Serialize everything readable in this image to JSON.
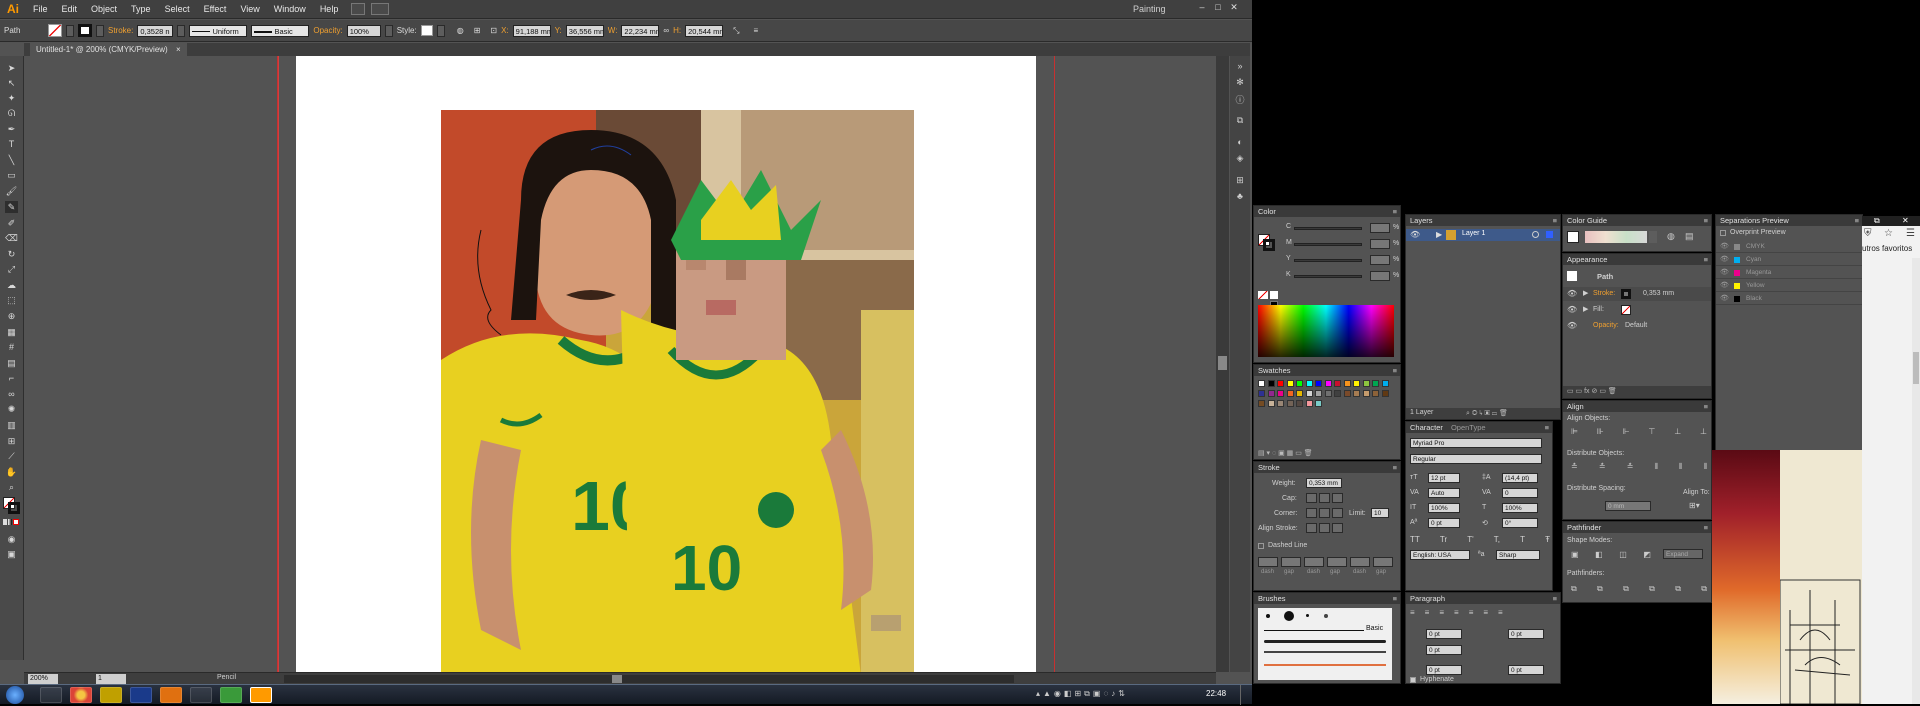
{
  "app": {
    "logo": "Ai",
    "menu": [
      "File",
      "Edit",
      "Object",
      "Type",
      "Select",
      "Effect",
      "View",
      "Window",
      "Help"
    ],
    "workspace": "Painting",
    "window_controls": [
      "–",
      "□",
      "✕"
    ]
  },
  "control_bar": {
    "object_type": "Path",
    "stroke_label": "Stroke:",
    "stroke_value": "0,3528 n",
    "stroke_profile": "Uniform",
    "brush": "Basic",
    "opacity_label": "Opacity:",
    "opacity_value": "100%",
    "style_label": "Style:",
    "x_label": "X:",
    "x_value": "91,188 mm",
    "y_label": "Y:",
    "y_value": "36,556 mm",
    "w_label": "W:",
    "w_value": "22,234 mm",
    "h_label": "H:",
    "h_value": "20,544 mm"
  },
  "document": {
    "tab_title": "Untitled-1* @ 200% (CMYK/Preview)",
    "close": "×"
  },
  "status": {
    "zoom": "200%",
    "page": "1",
    "tool": "Pencil"
  },
  "panels": {
    "color": {
      "title": "Color",
      "channels": [
        "C",
        "M",
        "Y",
        "K"
      ],
      "percent": "%"
    },
    "swatches": {
      "title": "Swatches",
      "colors": [
        "#ffffff",
        "#000000",
        "#ff0000",
        "#ffff00",
        "#00ff00",
        "#00ffff",
        "#0000ff",
        "#ff00ff",
        "#c8102e",
        "#f7941d",
        "#fff200",
        "#8dc63f",
        "#00a651",
        "#00aeef",
        "#2e3192",
        "#92278f",
        "#ec008c",
        "#f26522",
        "#e6b800",
        "#d4d4d4",
        "#a3a3a3",
        "#707070",
        "#404040",
        "#7a4a2a",
        "#a67c52",
        "#c69c6d",
        "#8c6239",
        "#603913",
        "#754c24",
        "#c7b299",
        "#998675",
        "#736357",
        "#534741",
        "#f5989d",
        "#7accc8"
      ]
    },
    "stroke": {
      "title": "Stroke",
      "weight_label": "Weight:",
      "weight_value": "0,353 mm",
      "cap_label": "Cap:",
      "corner_label": "Corner:",
      "limit_label": "Limit:",
      "limit_value": "10",
      "align_label": "Align Stroke:",
      "dashed_label": "Dashed Line",
      "dash_labels": [
        "dash",
        "gap",
        "dash",
        "gap",
        "dash",
        "gap"
      ]
    },
    "brushes": {
      "title": "Brushes",
      "basic": "Basic"
    },
    "layers": {
      "title": "Layers",
      "layer_name": "Layer 1",
      "footer": "1 Layer"
    },
    "character": {
      "title": "Character",
      "tab2": "OpenType",
      "font": "Myriad Pro",
      "style": "Regular",
      "size": "12 pt",
      "leading": "(14,4 pt)",
      "kerning": "Auto",
      "tracking": "0",
      "vscale": "100%",
      "hscale": "100%",
      "baseline": "0 pt",
      "rotation": "0°",
      "language": "English: USA",
      "aa": "Sharp",
      "tt": [
        "TT",
        "Tr",
        "T'",
        "T,",
        "T",
        "Ŧ"
      ]
    },
    "paragraph": {
      "title": "Paragraph",
      "indent_values": [
        "0 pt",
        "0 pt",
        "0 pt",
        "0 pt",
        "0 pt"
      ],
      "hyphenate": "Hyphenate"
    },
    "color_guide": {
      "title": "Color Guide"
    },
    "appearance": {
      "title": "Appearance",
      "object": "Path",
      "stroke_label": "Stroke:",
      "stroke_value": "0,353 mm",
      "fill_label": "Fill:",
      "opacity_label": "Opacity:",
      "opacity_value": "Default"
    },
    "align": {
      "title": "Align",
      "align_objects": "Align Objects:",
      "distribute_objects": "Distribute Objects:",
      "distribute_spacing": "Distribute Spacing:",
      "align_to": "Align To:",
      "spacing_value": "0 mm"
    },
    "pathfinder": {
      "title": "Pathfinder",
      "shape_modes": "Shape Modes:",
      "expand": "Expand",
      "pathfinders": "Pathfinders:"
    },
    "separations": {
      "title": "Separations Preview",
      "overprint": "Overprint Preview",
      "plates": [
        {
          "name": "CMYK",
          "color": "#888888"
        },
        {
          "name": "Cyan",
          "color": "#00aeef"
        },
        {
          "name": "Magenta",
          "color": "#ec008c"
        },
        {
          "name": "Yellow",
          "color": "#fff200"
        },
        {
          "name": "Black",
          "color": "#000000"
        }
      ]
    }
  },
  "taskbar": {
    "time": "22:48"
  },
  "browser": {
    "bookmarks_text": "utros favoritos"
  }
}
